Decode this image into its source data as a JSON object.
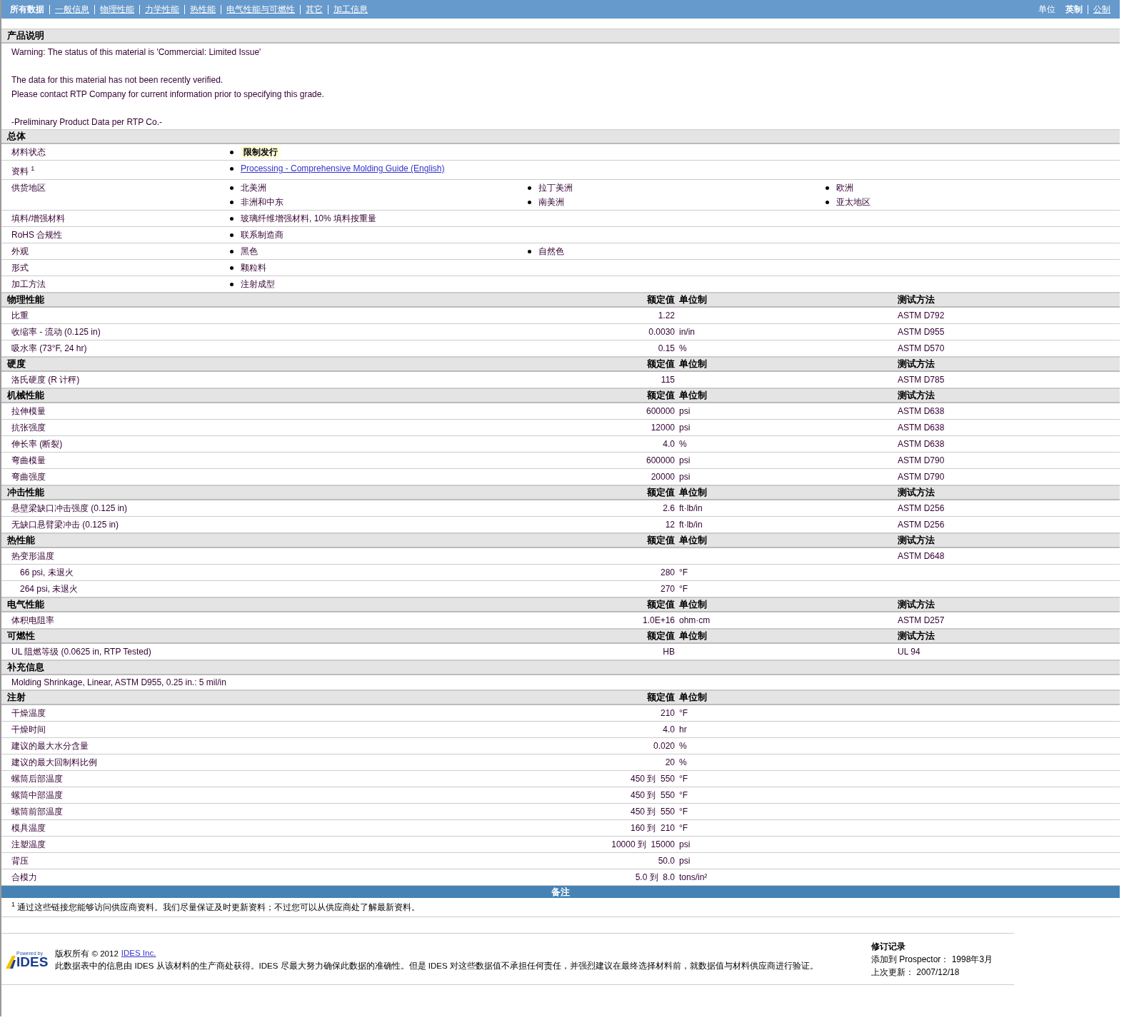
{
  "nav": {
    "tabs": [
      {
        "label": "所有数据",
        "selected": true
      },
      {
        "label": "一般信息",
        "selected": false
      },
      {
        "label": "物理性能",
        "selected": false
      },
      {
        "label": "力学性能",
        "selected": false
      },
      {
        "label": "热性能",
        "selected": false
      },
      {
        "label": "电气性能与可燃性",
        "selected": false
      },
      {
        "label": "其它",
        "selected": false
      },
      {
        "label": "加工信息",
        "selected": false
      }
    ],
    "units_label": "单位",
    "units": [
      {
        "label": "英制",
        "selected": true
      },
      {
        "label": "公制",
        "selected": false
      }
    ]
  },
  "description": {
    "title": "产品说明",
    "paragraphs": [
      [
        "Warning: The status of this material is 'Commercial: Limited Issue'"
      ],
      [
        "The data for this material has not been recently verified.",
        "Please contact RTP Company for current information prior to specifying this grade."
      ],
      [
        "-Preliminary Product Data per RTP Co.-"
      ]
    ]
  },
  "general": {
    "title": "总体",
    "rows": [
      {
        "label": "材料状态",
        "items": [
          {
            "kind": "status",
            "text": "限制发行"
          }
        ]
      },
      {
        "label": "资料 $^{1}$",
        "items": [
          {
            "kind": "link",
            "text": "Processing - Comprehensive Molding Guide (English)"
          }
        ]
      },
      {
        "label": "供货地区",
        "items": [
          {
            "kind": "text",
            "text": "北美洲"
          },
          {
            "kind": "text",
            "text": "拉丁美洲"
          },
          {
            "kind": "text",
            "text": "欧洲"
          },
          {
            "kind": "text",
            "text": "非洲和中东"
          },
          {
            "kind": "text",
            "text": "南美洲"
          },
          {
            "kind": "text",
            "text": "亚太地区"
          }
        ]
      },
      {
        "label": "填料/增强材料",
        "items": [
          {
            "kind": "text",
            "text": "玻璃纤维增强材料, 10% 填料按重量"
          }
        ]
      },
      {
        "label": "RoHS 合规性",
        "items": [
          {
            "kind": "text",
            "text": "联系制造商"
          }
        ]
      },
      {
        "label": "外观",
        "items": [
          {
            "kind": "text",
            "text": "黑色"
          },
          {
            "kind": "text",
            "text": "自然色"
          }
        ]
      },
      {
        "label": "形式",
        "items": [
          {
            "kind": "text",
            "text": "颗粒料"
          }
        ]
      },
      {
        "label": "加工方法",
        "items": [
          {
            "kind": "text",
            "text": "注射成型"
          }
        ]
      }
    ]
  },
  "sections": [
    {
      "kind": "table",
      "title": "物理性能",
      "value_header": "额定值",
      "unit_header": "单位制",
      "method_header": "测试方法",
      "rows": [
        {
          "name": "比重",
          "value": "1.22",
          "method": "ASTM D792"
        },
        {
          "name": "收缩率 - 流动",
          "condition": "(0.125 in)",
          "value": "0.0030",
          "unit": "in/in",
          "method": "ASTM D955"
        },
        {
          "name": "吸水率",
          "condition": "(73°F, 24 hr)",
          "value": "0.15",
          "unit": "%",
          "method": "ASTM D570"
        }
      ]
    },
    {
      "kind": "table",
      "title": "硬度",
      "value_header": "额定值",
      "unit_header": "单位制",
      "method_header": "测试方法",
      "rows": [
        {
          "name": "洛氏硬度",
          "condition": "(R 计秤)",
          "value": "115",
          "method": "ASTM D785"
        }
      ]
    },
    {
      "kind": "table",
      "title": "机械性能",
      "value_header": "额定值",
      "unit_header": "单位制",
      "method_header": "测试方法",
      "rows": [
        {
          "name": "拉伸模量",
          "value": "600000",
          "unit": "psi",
          "method": "ASTM D638"
        },
        {
          "name": "抗张强度",
          "value": "12000",
          "unit": "psi",
          "method": "ASTM D638"
        },
        {
          "name": "伸长率",
          "condition": "(断裂)",
          "value": "4.0",
          "unit": "%",
          "method": "ASTM D638"
        },
        {
          "name": "弯曲模量",
          "value": "600000",
          "unit": "psi",
          "method": "ASTM D790"
        },
        {
          "name": "弯曲强度",
          "value": "20000",
          "unit": "psi",
          "method": "ASTM D790"
        }
      ]
    },
    {
      "kind": "table",
      "title": "冲击性能",
      "value_header": "额定值",
      "unit_header": "单位制",
      "method_header": "测试方法",
      "rows": [
        {
          "name": "悬壁梁缺口冲击强度",
          "condition": "(0.125 in)",
          "value": "2.6",
          "unit": "ft·lb/in",
          "method": "ASTM D256"
        },
        {
          "name": "无缺口悬臂梁冲击",
          "condition": "(0.125 in)",
          "value": "12",
          "unit": "ft·lb/in",
          "method": "ASTM D256"
        }
      ]
    },
    {
      "kind": "table",
      "title": "热性能",
      "value_header": "额定值",
      "unit_header": "单位制",
      "method_header": "测试方法",
      "rows": [
        {
          "name": "热变形温度",
          "method": "ASTM D648",
          "children": [
            {
              "name": "66 psi, 未退火",
              "value": "280",
              "unit": "°F"
            },
            {
              "name": "264 psi, 未退火",
              "value": "270",
              "unit": "°F"
            }
          ]
        }
      ]
    },
    {
      "kind": "table",
      "title": "电气性能",
      "value_header": "额定值",
      "unit_header": "单位制",
      "method_header": "测试方法",
      "rows": [
        {
          "name": "体积电阻率",
          "value": "1.0E+16",
          "unit": "ohm·cm",
          "method": "ASTM D257"
        }
      ]
    },
    {
      "kind": "table",
      "title": "可燃性",
      "value_header": "额定值",
      "unit_header": "单位制",
      "method_header": "测试方法",
      "rows": [
        {
          "name": "UL 阻燃等级",
          "condition": "(0.0625 in, RTP Tested)",
          "value": "HB",
          "method": "UL 94"
        }
      ]
    },
    {
      "kind": "note",
      "title": "补充信息",
      "text": "Molding Shrinkage, Linear, ASTM D955, 0.25 in.: 5 mil/in"
    },
    {
      "kind": "table",
      "title": "注射",
      "value_header": "额定值",
      "unit_header": "单位制",
      "rows": [
        {
          "name": "干燥温度",
          "value": "210",
          "unit": "°F"
        },
        {
          "name": "干燥时间",
          "value": "4.0",
          "unit": "hr"
        },
        {
          "name": "建议的最大水分含量",
          "value": "0.020",
          "unit": "%"
        },
        {
          "name": "建议的最大回制料比例",
          "value": "20",
          "unit": "%"
        },
        {
          "name": "螺筒后部温度",
          "value": "450 到  550",
          "unit": "°F"
        },
        {
          "name": "螺筒中部温度",
          "value": "450 到  550",
          "unit": "°F"
        },
        {
          "name": "螺筒前部温度",
          "value": "450 到  550",
          "unit": "°F"
        },
        {
          "name": "模具温度",
          "value": "160 到  210",
          "unit": "°F"
        },
        {
          "name": "注塑温度",
          "value": "10000 到  15000",
          "unit": "psi"
        },
        {
          "name": "背压",
          "value": "50.0",
          "unit": "psi"
        },
        {
          "name": "合模力",
          "value": "5.0 到  8.0",
          "unit": "tons/in²"
        }
      ]
    }
  ],
  "notes": {
    "title": "备注",
    "footnote": "$^{1}$ 通过这些链接您能够访问供应商资料。我们尽量保证及时更新资料；不过您可以从供应商处了解最新资料。"
  },
  "footer": {
    "logo": {
      "tagline": "Powered by",
      "name": "IDES"
    },
    "copyright": "版权所有 © 2012",
    "company_link": "IDES Inc.",
    "disclaimer": "此数据表中的信息由 IDES 从该材料的生产商处获得。IDES 尽最大努力确保此数据的准确性。但是 IDES 对这些数据值不承担任何责任，并强烈建议在最终选择材料前，就数据值与材料供应商进行验证。",
    "revision": {
      "title": "修订记录",
      "lines": [
        "添加到 Prospector： 1998年3月",
        "上次更新： 2007/12/18"
      ]
    }
  }
}
